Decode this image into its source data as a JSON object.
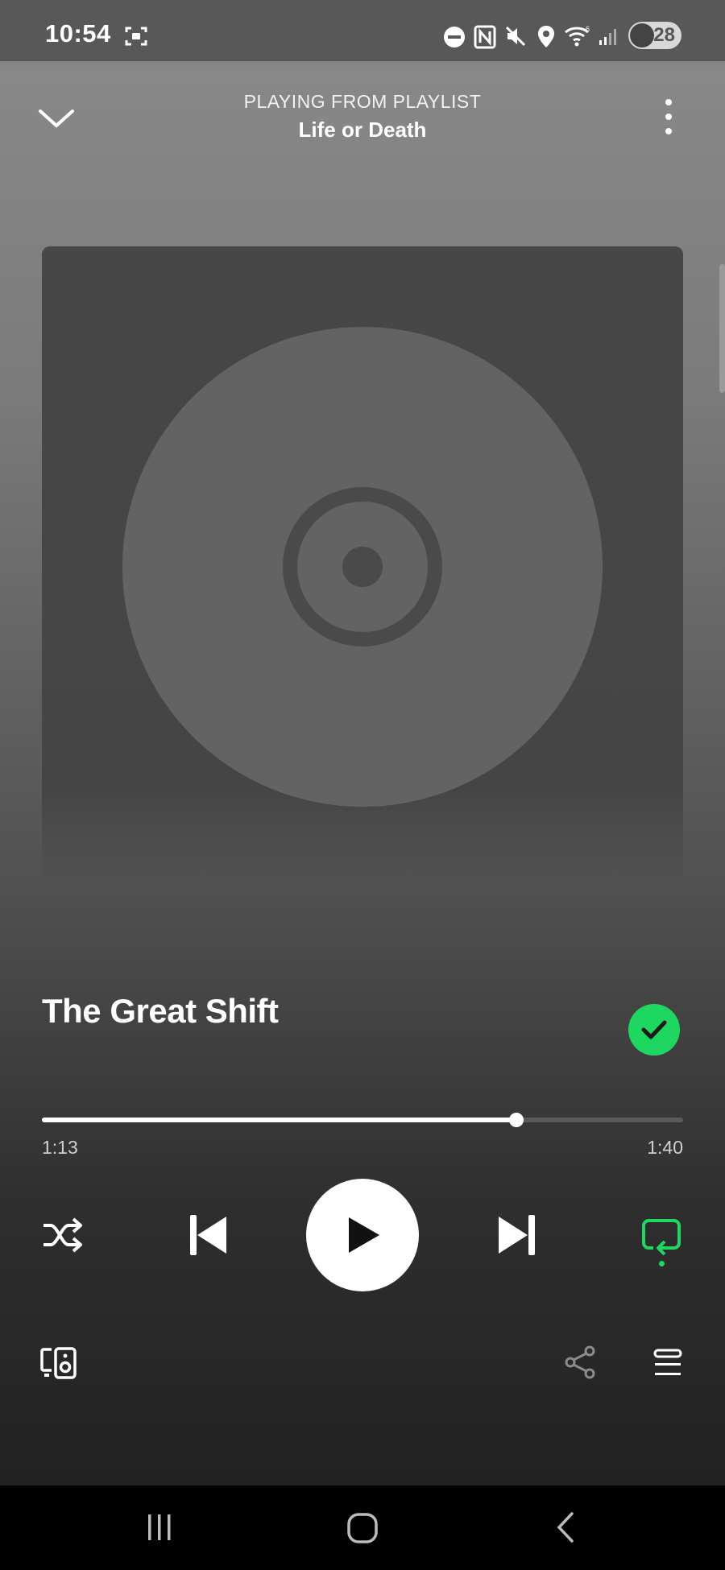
{
  "status_bar": {
    "time": "10:54",
    "battery": "28",
    "icons": [
      "screen-record-icon",
      "do-not-disturb-icon",
      "nfc-icon",
      "mute-icon",
      "location-icon",
      "wifi-icon",
      "signal-icon"
    ]
  },
  "header": {
    "context_label": "PLAYING FROM PLAYLIST",
    "playlist_name": "Life or Death",
    "collapse_icon": "chevron-down-icon",
    "menu_icon": "more-vertical-icon"
  },
  "track": {
    "title": "The Great Shift",
    "liked": true,
    "elapsed": "1:13",
    "duration": "1:40",
    "progress": 0.74
  },
  "controls": {
    "shuffle_icon": "shuffle-icon",
    "previous_icon": "skip-previous-icon",
    "play_icon": "play-icon",
    "next_icon": "skip-next-icon",
    "repeat_icon": "repeat-icon",
    "repeat_active": true
  },
  "footer": {
    "devices_icon": "connect-device-icon",
    "share_icon": "share-icon",
    "queue_icon": "queue-icon"
  },
  "colors": {
    "accent": "#1ed760",
    "status_bar": "#585858",
    "nav_bar": "#000000"
  }
}
